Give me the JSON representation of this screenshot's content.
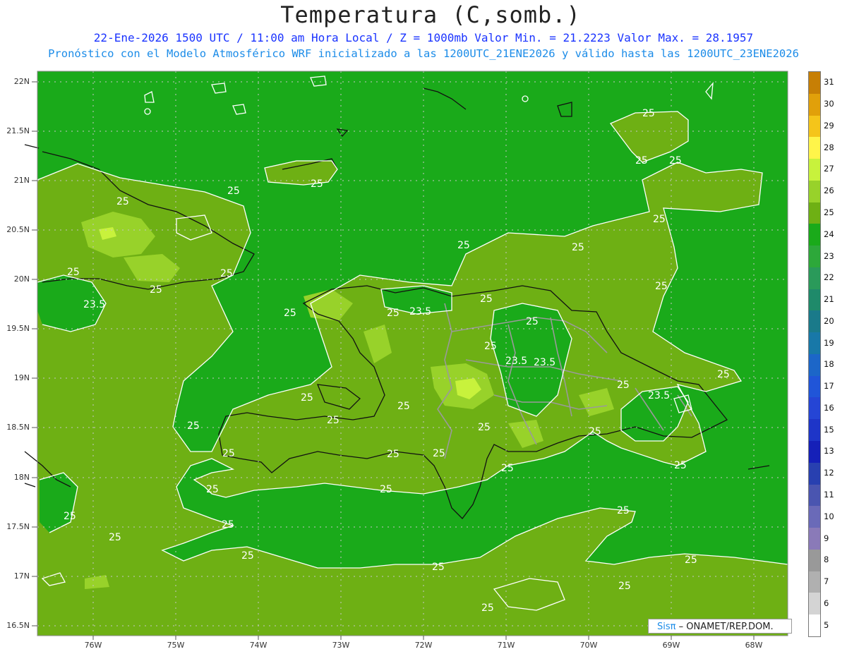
{
  "header": {
    "title": "Temperatura (C,somb.)",
    "line1": "22-Ene-2026 1500 UTC / 11:00 am Hora Local / Z = 1000mb  Valor Min. = 21.2223  Valor Max. = 28.1957",
    "line2": "Pronóstico con el Modelo Atmosférico WRF inicializado a las 1200UTC_21ENE2026 y válido hasta las  1200UTC_23ENE2026"
  },
  "axes": {
    "lat_labels": [
      "22N",
      "21.5N",
      "21N",
      "20.5N",
      "20N",
      "19.5N",
      "19N",
      "18.5N",
      "18N",
      "17.5N",
      "17N",
      "16.5N"
    ],
    "lon_labels": [
      "76W",
      "75W",
      "74W",
      "73W",
      "72W",
      "71W",
      "70W",
      "69W",
      "68W"
    ]
  },
  "legend": {
    "labels": [
      "31",
      "30",
      "29",
      "28",
      "27",
      "26",
      "25",
      "24",
      "23",
      "22",
      "21",
      "20",
      "19",
      "18",
      "17",
      "16",
      "15",
      "13",
      "12",
      "11",
      "10",
      "9",
      "8",
      "7",
      "6",
      "5"
    ],
    "colors": [
      "#c77f05",
      "#e1a00a",
      "#f5c51a",
      "#fff54a",
      "#c8f23c",
      "#98d22a",
      "#6eb014",
      "#1aaa1a",
      "#2da83a",
      "#2a9a5a",
      "#1f8a6a",
      "#1a7a8a",
      "#1878a8",
      "#1c66c8",
      "#2055d8",
      "#2545d5",
      "#1e35c8",
      "#1520b8",
      "#2840b0",
      "#4a55b0",
      "#6a6ab8",
      "#8a7ab8",
      "#999999",
      "#b0b0b0",
      "#d4d4d4",
      "#ffffff"
    ]
  },
  "contour_labels": [
    "25",
    "23.5"
  ],
  "credit": {
    "sis": "Sisπ",
    "rest": " – ONAMET/REP.DOM."
  }
}
